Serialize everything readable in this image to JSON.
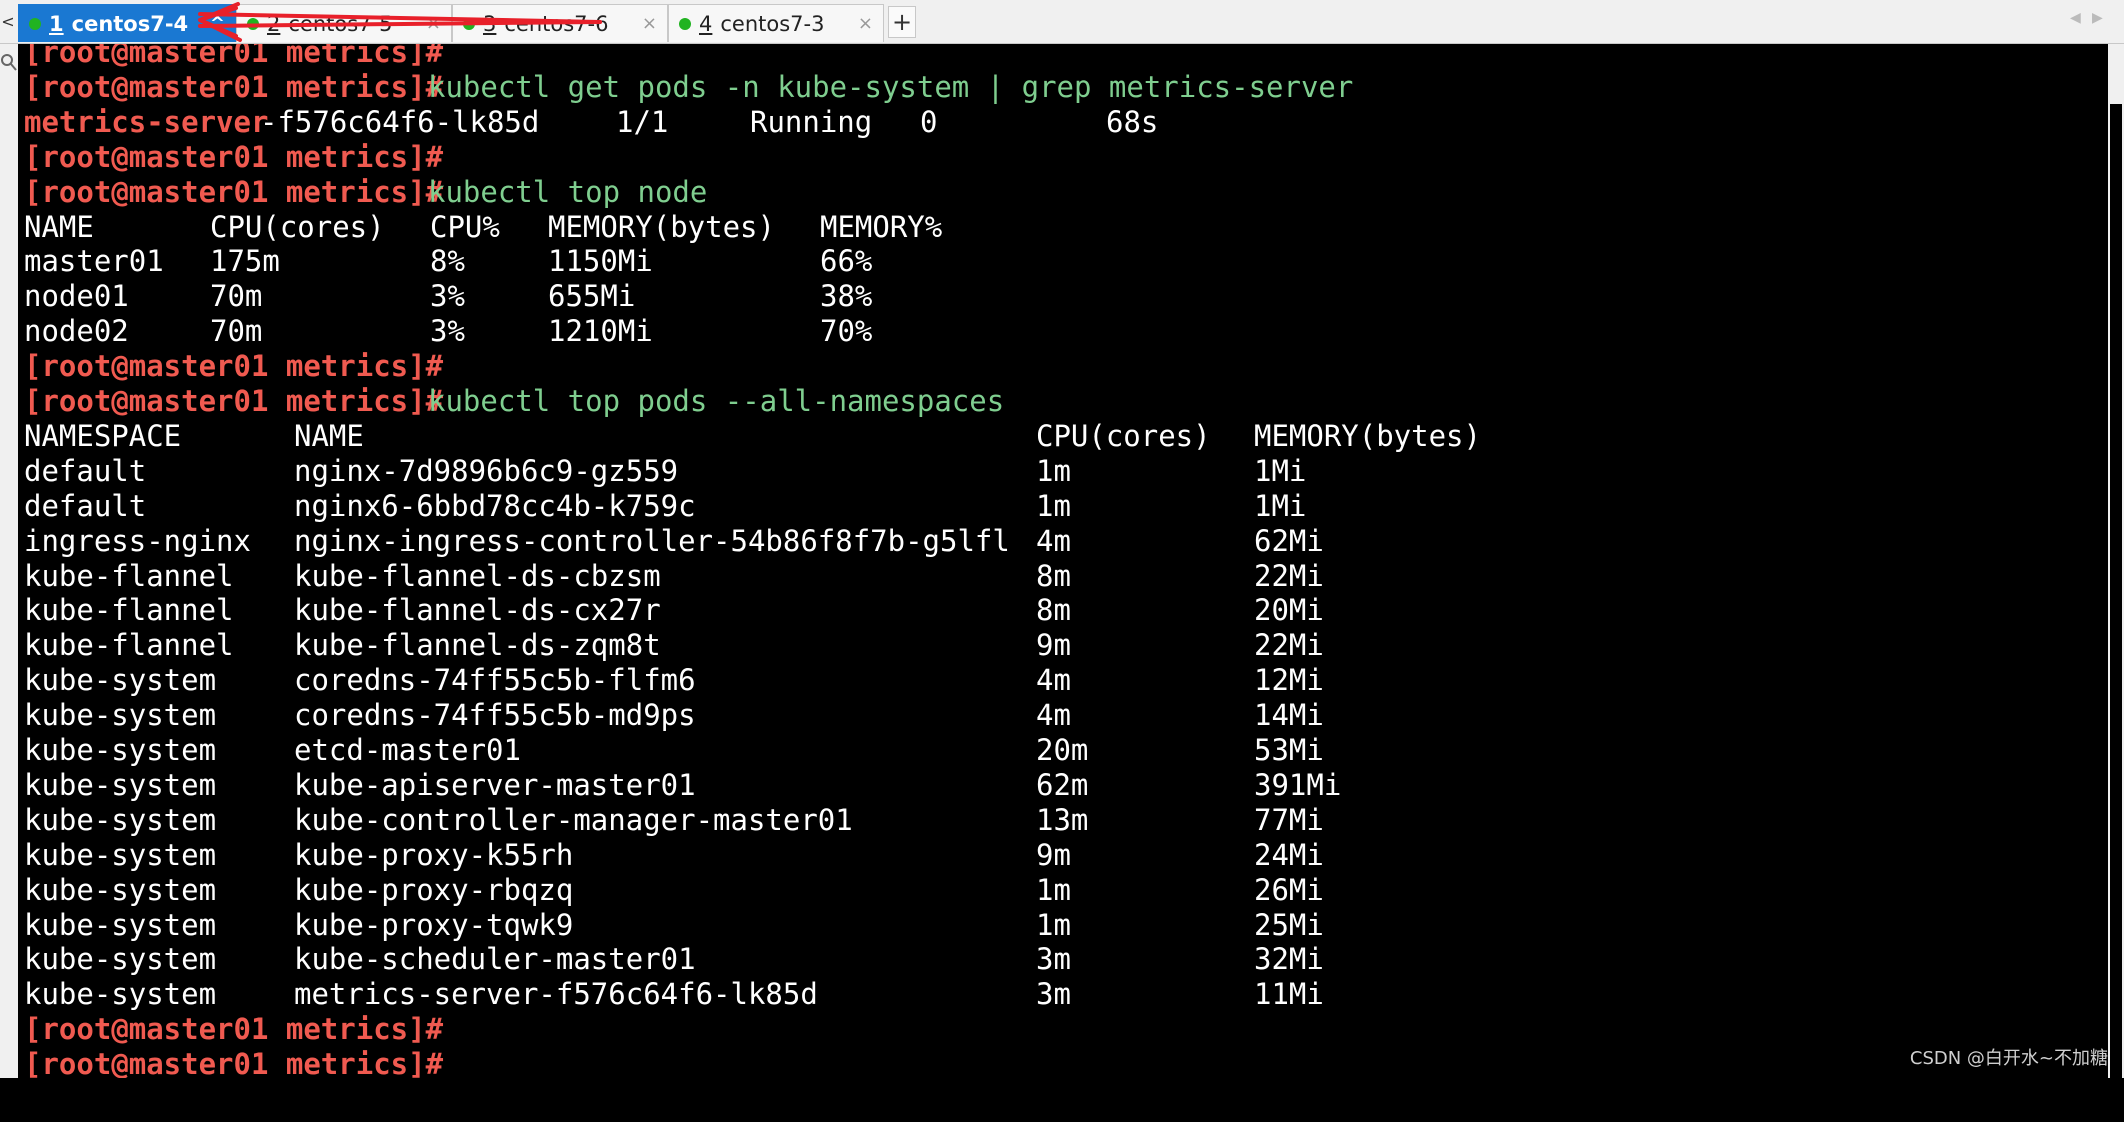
{
  "tabs": [
    {
      "num": "1",
      "label": "centos7-4",
      "active": true,
      "close": "^"
    },
    {
      "num": "2",
      "label": "centos7-5",
      "active": false,
      "close": "×"
    },
    {
      "num": "3",
      "label": "centos7-6",
      "active": false,
      "close": "×"
    },
    {
      "num": "4",
      "label": "centos7-3",
      "active": false,
      "close": "×"
    }
  ],
  "tabbar": {
    "add_label": "+",
    "left_nav": "<",
    "scroll_left": "◀",
    "scroll_right": "▶"
  },
  "colors": {
    "prompt": "#f05a50",
    "command": "#7fce8f",
    "active_tab": "#1a78d2",
    "status_dot": "#21b321"
  },
  "icons": {
    "left_search": "search-icon"
  },
  "terminal": {
    "prompt": "[root@master01 metrics]#",
    "lines": [
      {
        "type": "prompt",
        "cmd": ""
      },
      {
        "type": "prompt",
        "cmd": "kubectl get pods -n kube-system | grep metrics-server"
      },
      {
        "type": "grep",
        "hl": "metrics-server",
        "cols": [
          "-f576c64f6-lk85d",
          "1/1",
          "Running",
          "0",
          "68s"
        ]
      },
      {
        "type": "prompt",
        "cmd": ""
      },
      {
        "type": "prompt",
        "cmd": "kubectl top node"
      },
      {
        "type": "node",
        "cols": [
          "NAME",
          "CPU(cores)",
          "CPU%",
          "MEMORY(bytes)",
          "MEMORY%"
        ]
      },
      {
        "type": "node",
        "cols": [
          "master01",
          "175m",
          "8%",
          "1150Mi",
          "66%"
        ]
      },
      {
        "type": "node",
        "cols": [
          "node01",
          "70m",
          "3%",
          "655Mi",
          "38%"
        ]
      },
      {
        "type": "node",
        "cols": [
          "node02",
          "70m",
          "3%",
          "1210Mi",
          "70%"
        ]
      },
      {
        "type": "prompt",
        "cmd": ""
      },
      {
        "type": "prompt",
        "cmd": "kubectl top pods --all-namespaces"
      },
      {
        "type": "pod",
        "cols": [
          "NAMESPACE",
          "NAME",
          "CPU(cores)",
          "MEMORY(bytes)"
        ]
      },
      {
        "type": "pod",
        "cols": [
          "default",
          "nginx-7d9896b6c9-gz559",
          "1m",
          "1Mi"
        ]
      },
      {
        "type": "pod",
        "cols": [
          "default",
          "nginx6-6bbd78cc4b-k759c",
          "1m",
          "1Mi"
        ]
      },
      {
        "type": "pod",
        "cols": [
          "ingress-nginx",
          "nginx-ingress-controller-54b86f8f7b-g5lfl",
          "4m",
          "62Mi"
        ]
      },
      {
        "type": "pod",
        "cols": [
          "kube-flannel",
          "kube-flannel-ds-cbzsm",
          "8m",
          "22Mi"
        ]
      },
      {
        "type": "pod",
        "cols": [
          "kube-flannel",
          "kube-flannel-ds-cx27r",
          "8m",
          "20Mi"
        ]
      },
      {
        "type": "pod",
        "cols": [
          "kube-flannel",
          "kube-flannel-ds-zqm8t",
          "9m",
          "22Mi"
        ]
      },
      {
        "type": "pod",
        "cols": [
          "kube-system",
          "coredns-74ff55c5b-flfm6",
          "4m",
          "12Mi"
        ]
      },
      {
        "type": "pod",
        "cols": [
          "kube-system",
          "coredns-74ff55c5b-md9ps",
          "4m",
          "14Mi"
        ]
      },
      {
        "type": "pod",
        "cols": [
          "kube-system",
          "etcd-master01",
          "20m",
          "53Mi"
        ]
      },
      {
        "type": "pod",
        "cols": [
          "kube-system",
          "kube-apiserver-master01",
          "62m",
          "391Mi"
        ]
      },
      {
        "type": "pod",
        "cols": [
          "kube-system",
          "kube-controller-manager-master01",
          "13m",
          "77Mi"
        ]
      },
      {
        "type": "pod",
        "cols": [
          "kube-system",
          "kube-proxy-k55rh",
          "9m",
          "24Mi"
        ]
      },
      {
        "type": "pod",
        "cols": [
          "kube-system",
          "kube-proxy-rbqzq",
          "1m",
          "26Mi"
        ]
      },
      {
        "type": "pod",
        "cols": [
          "kube-system",
          "kube-proxy-tqwk9",
          "1m",
          "25Mi"
        ]
      },
      {
        "type": "pod",
        "cols": [
          "kube-system",
          "kube-scheduler-master01",
          "3m",
          "32Mi"
        ]
      },
      {
        "type": "pod",
        "cols": [
          "kube-system",
          "metrics-server-f576c64f6-lk85d",
          "3m",
          "11Mi"
        ]
      },
      {
        "type": "prompt",
        "cmd": ""
      },
      {
        "type": "prompt",
        "cmd": ""
      }
    ]
  },
  "watermark": "CSDN @白开水~不加糖"
}
